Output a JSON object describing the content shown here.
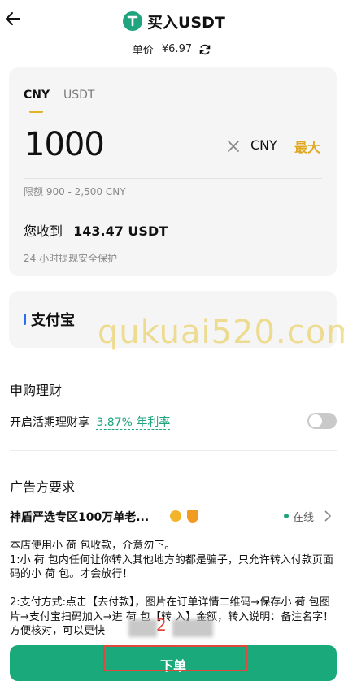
{
  "header": {
    "title": "买入USDT",
    "logo_letter": "T"
  },
  "price": {
    "label": "单价",
    "value": "¥6.97"
  },
  "tabs": [
    {
      "label": "CNY",
      "active": true
    },
    {
      "label": "USDT",
      "active": false
    }
  ],
  "amount": {
    "value": "1000",
    "currency": "CNY",
    "max_label": "最大",
    "limit_text": "限额 900 - 2,500 CNY"
  },
  "receive": {
    "label": "您收到",
    "value": "143.47 USDT",
    "safety_note": "24 小时提现安全保护"
  },
  "payment": {
    "method": "支付宝"
  },
  "wealth": {
    "title": "申购理财",
    "toggle_label": "开启活期理财享",
    "rate": "3.87% 年利率",
    "enabled": false
  },
  "ad": {
    "title": "广告方要求",
    "merchant": "神盾严选专区100万单老...",
    "status": "在线",
    "lines": [
      "本店使用小 荷 包收款，介意勿下。",
      "1:小 荷 包内任何让你转入其他地方的都是骗子，只允许转入付款页面码的小 荷 包。才会放行！",
      "",
      "2:支付方式:点击【去付款】，图片在订单详情二维码→保存小 荷 包图片→支付宝扫码加入→进 荷 包【转 入】金额，转入说明：备注名字！方便核对，可以更快"
    ]
  },
  "order_button": {
    "label": "下单"
  },
  "annotation": {
    "marker": "2"
  },
  "watermark": {
    "text": "qukuai520.com"
  },
  "colors": {
    "accent_green": "#1aa97a",
    "max_gold": "#e0a81f",
    "highlight_red": "#e0473d",
    "card_bg": "#f5f5f5"
  }
}
